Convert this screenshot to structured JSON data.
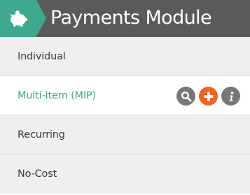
{
  "header": {
    "title": "Payments Module",
    "icon": "piggy-bank-icon",
    "accent_color": "#3ea88e",
    "bar_color": "#5a5a5a"
  },
  "menu": {
    "items": [
      {
        "label": "Individual",
        "active": false
      },
      {
        "label": "Multi-Item (MIP)",
        "active": true
      },
      {
        "label": "Recurring",
        "active": false
      },
      {
        "label": "No-Cost",
        "active": false
      }
    ],
    "active_actions": [
      {
        "icon": "search-icon",
        "color": "#777777"
      },
      {
        "icon": "plus-icon",
        "color": "#f26322"
      },
      {
        "icon": "info-icon",
        "color": "#777777"
      }
    ],
    "active_text_color": "#3ea88e"
  }
}
